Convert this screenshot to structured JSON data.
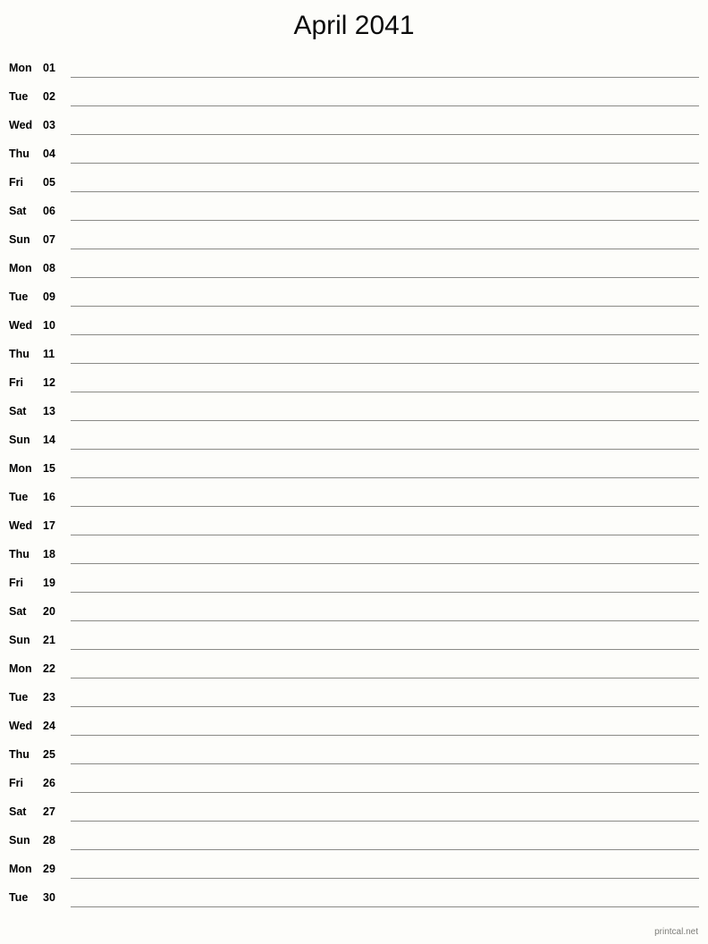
{
  "page": {
    "title": "April 2041",
    "background_color": "#fdfdfa",
    "rule_color": "#8a8a86",
    "text_color": "#000000"
  },
  "footer": {
    "text": "printcal.net",
    "color": "#7d7d79"
  },
  "calendar": {
    "month": "April",
    "year": "2041",
    "days": [
      {
        "weekday": "Mon",
        "day": "01"
      },
      {
        "weekday": "Tue",
        "day": "02"
      },
      {
        "weekday": "Wed",
        "day": "03"
      },
      {
        "weekday": "Thu",
        "day": "04"
      },
      {
        "weekday": "Fri",
        "day": "05"
      },
      {
        "weekday": "Sat",
        "day": "06"
      },
      {
        "weekday": "Sun",
        "day": "07"
      },
      {
        "weekday": "Mon",
        "day": "08"
      },
      {
        "weekday": "Tue",
        "day": "09"
      },
      {
        "weekday": "Wed",
        "day": "10"
      },
      {
        "weekday": "Thu",
        "day": "11"
      },
      {
        "weekday": "Fri",
        "day": "12"
      },
      {
        "weekday": "Sat",
        "day": "13"
      },
      {
        "weekday": "Sun",
        "day": "14"
      },
      {
        "weekday": "Mon",
        "day": "15"
      },
      {
        "weekday": "Tue",
        "day": "16"
      },
      {
        "weekday": "Wed",
        "day": "17"
      },
      {
        "weekday": "Thu",
        "day": "18"
      },
      {
        "weekday": "Fri",
        "day": "19"
      },
      {
        "weekday": "Sat",
        "day": "20"
      },
      {
        "weekday": "Sun",
        "day": "21"
      },
      {
        "weekday": "Mon",
        "day": "22"
      },
      {
        "weekday": "Tue",
        "day": "23"
      },
      {
        "weekday": "Wed",
        "day": "24"
      },
      {
        "weekday": "Thu",
        "day": "25"
      },
      {
        "weekday": "Fri",
        "day": "26"
      },
      {
        "weekday": "Sat",
        "day": "27"
      },
      {
        "weekday": "Sun",
        "day": "28"
      },
      {
        "weekday": "Mon",
        "day": "29"
      },
      {
        "weekday": "Tue",
        "day": "30"
      }
    ]
  }
}
